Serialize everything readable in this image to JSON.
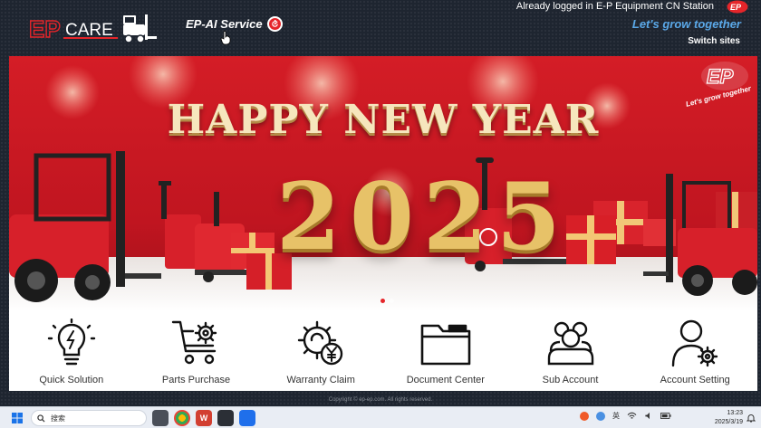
{
  "header": {
    "logo_text": "CARE",
    "ai_service": "EP-AI Service",
    "logged_in": "Already logged in E-P Equipment CN Station",
    "slogan": "Let's grow together",
    "switch_sites": "Switch sites"
  },
  "banner": {
    "title": "HAPPY NEW YEAR",
    "year": "2025",
    "slogan": "Let's grow together",
    "slide_count": 2,
    "active_slide": 1
  },
  "services": [
    {
      "label": "Quick Solution",
      "icon": "lightbulb-icon"
    },
    {
      "label": "Parts Purchase",
      "icon": "cart-gear-icon"
    },
    {
      "label": "Warranty Claim",
      "icon": "gear-yen-icon"
    },
    {
      "label": "Document Center",
      "icon": "folder-icon"
    },
    {
      "label": "Sub Account",
      "icon": "group-icon"
    },
    {
      "label": "Account Setting",
      "icon": "user-gear-icon"
    }
  ],
  "footer": {
    "copyright": "Copyright © ep-ep.com. All rights reserved."
  },
  "taskbar": {
    "search_placeholder": "搜索",
    "ime": "英",
    "time": "13:23",
    "date": "2025/3/19"
  },
  "colors": {
    "brand_red": "#e5252a",
    "slogan_blue": "#5aa8e8",
    "dark_bg": "#1e2530"
  }
}
